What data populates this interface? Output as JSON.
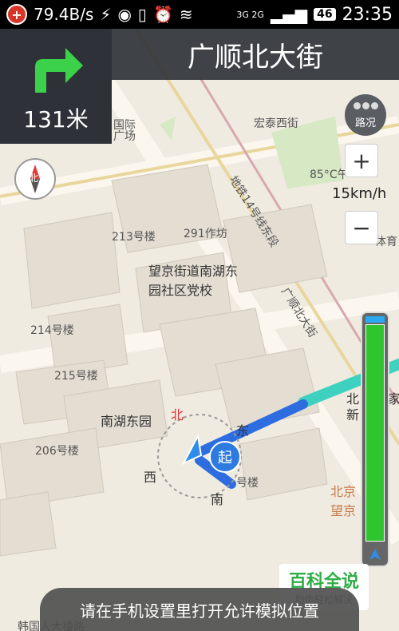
{
  "status_bar": {
    "net_speed": "79.4B/s",
    "network": "3G 2G",
    "battery": "46",
    "time": "23:35"
  },
  "navigation": {
    "distance": "131米",
    "road_name": "广顺北大街",
    "turn": "right-turn-icon"
  },
  "controls": {
    "traffic_label": "路况",
    "zoom_in": "+",
    "zoom_out": "−",
    "speed": "15km/h",
    "compass_label": "北",
    "route_progress": 0.97
  },
  "map_labels": {
    "guoji": "国际",
    "guangchang": "广场",
    "hongtai": "宏泰西街",
    "metro": "地铁14号线东段",
    "n85": "85°C午",
    "tiyu": "体育",
    "b213": "213号楼",
    "b291": "291作坊",
    "school": "望京街道南湖东园社区党校",
    "guangshun": "广顺北大街",
    "b214": "214号楼",
    "b215": "215号楼",
    "nanhu": "南湖东园",
    "b206": "206号楼",
    "north": "北",
    "east": "东",
    "west": "西",
    "south": "南",
    "start": "起",
    "bei": "北",
    "jia": "家",
    "xin": "新",
    "beijing": "北京",
    "wangjing": "望京",
    "b5hao": "号楼",
    "hanguo": "韩国人大楼路"
  },
  "watermark": {
    "title": "百科全说",
    "subtitle": "助你轻松解决"
  },
  "toast": "请在手机设置里打开允许模拟位置"
}
